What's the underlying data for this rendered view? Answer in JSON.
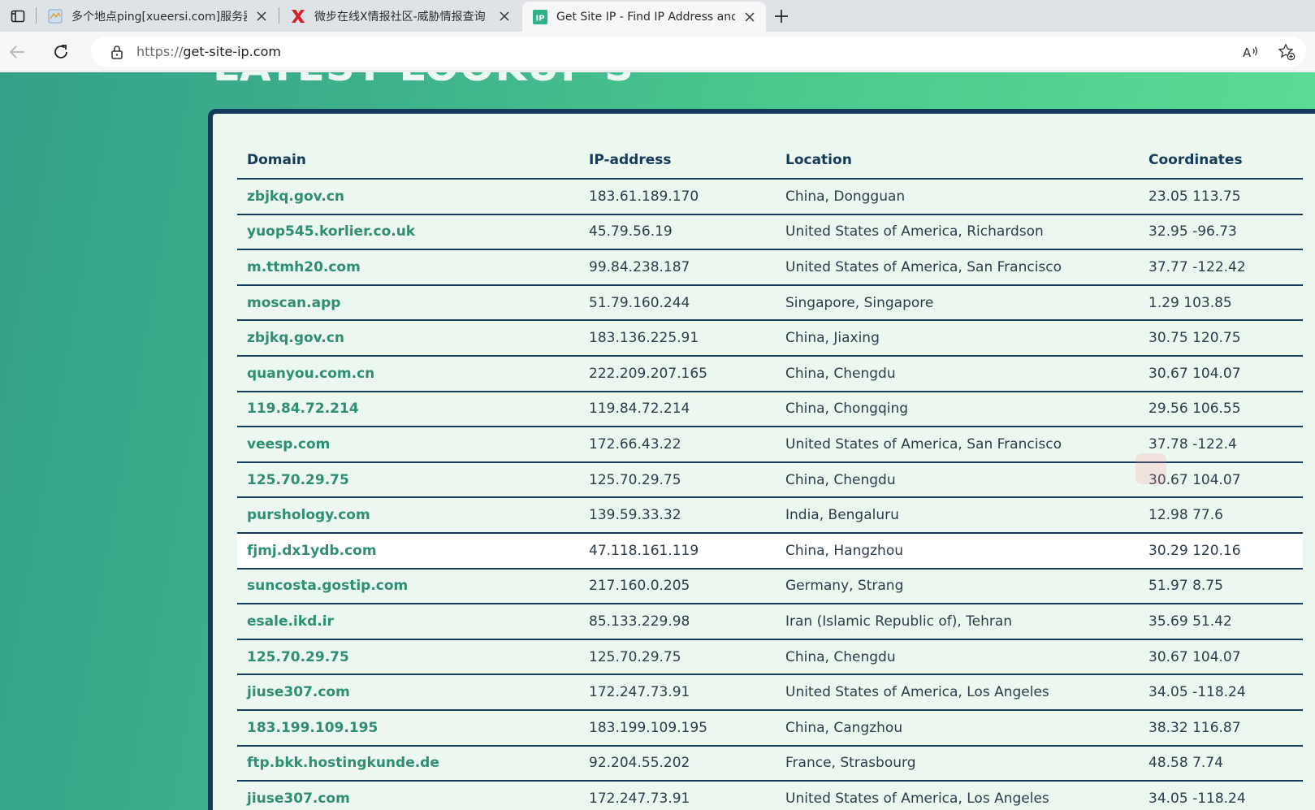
{
  "browser": {
    "tabs": [
      {
        "title": "多个地点ping[xueersi.com]服务器",
        "favicon": "globe-map-icon",
        "active": false
      },
      {
        "title": "微步在线X情报社区-威胁情报查询",
        "favicon": "x-logo-icon",
        "active": false
      },
      {
        "title": "Get Site IP - Find IP Address and",
        "favicon": "ip-logo-icon",
        "active": true
      }
    ],
    "address_bar": {
      "scheme": "https://",
      "host": "get-site-ip.com"
    },
    "colors": {
      "tab_strip": "#dfe3e8",
      "active_tab": "#f7f7f7",
      "x_logo": "#d6202a",
      "ip_logo": "#2bb38a"
    }
  },
  "page": {
    "heading": "LATEST LOOKUP'S",
    "table": {
      "headers": {
        "domain": "Domain",
        "ip": "IP-address",
        "location": "Location",
        "coordinates": "Coordinates"
      },
      "rows": [
        {
          "domain": "zbjkq.gov.cn",
          "ip": "183.61.189.170",
          "location": "China, Dongguan",
          "coordinates": "23.05 113.75"
        },
        {
          "domain": "yuop545.korlier.co.uk",
          "ip": "45.79.56.19",
          "location": "United States of America, Richardson",
          "coordinates": "32.95 -96.73"
        },
        {
          "domain": "m.ttmh20.com",
          "ip": "99.84.238.187",
          "location": "United States of America, San Francisco",
          "coordinates": "37.77 -122.42"
        },
        {
          "domain": "moscan.app",
          "ip": "51.79.160.244",
          "location": "Singapore, Singapore",
          "coordinates": "1.29 103.85"
        },
        {
          "domain": "zbjkq.gov.cn",
          "ip": "183.136.225.91",
          "location": "China, Jiaxing",
          "coordinates": "30.75 120.75"
        },
        {
          "domain": "quanyou.com.cn",
          "ip": "222.209.207.165",
          "location": "China, Chengdu",
          "coordinates": "30.67 104.07"
        },
        {
          "domain": "119.84.72.214",
          "ip": "119.84.72.214",
          "location": "China, Chongqing",
          "coordinates": "29.56 106.55"
        },
        {
          "domain": "veesp.com",
          "ip": "172.66.43.22",
          "location": "United States of America, San Francisco",
          "coordinates": "37.78 -122.4"
        },
        {
          "domain": "125.70.29.75",
          "ip": "125.70.29.75",
          "location": "China, Chengdu",
          "coordinates": "30.67 104.07"
        },
        {
          "domain": "purshology.com",
          "ip": "139.59.33.32",
          "location": "India, Bengaluru",
          "coordinates": "12.98 77.6"
        },
        {
          "domain": "fjmj.dx1ydb.com",
          "ip": "47.118.161.119",
          "location": "China, Hangzhou",
          "coordinates": "30.29 120.16",
          "highlighted": true
        },
        {
          "domain": "suncosta.gostip.com",
          "ip": "217.160.0.205",
          "location": "Germany, Strang",
          "coordinates": "51.97 8.75"
        },
        {
          "domain": "esale.ikd.ir",
          "ip": "85.133.229.98",
          "location": "Iran (Islamic Republic of), Tehran",
          "coordinates": "35.69 51.42"
        },
        {
          "domain": "125.70.29.75",
          "ip": "125.70.29.75",
          "location": "China, Chengdu",
          "coordinates": "30.67 104.07"
        },
        {
          "domain": "jiuse307.com",
          "ip": "172.247.73.91",
          "location": "United States of America, Los Angeles",
          "coordinates": "34.05 -118.24"
        },
        {
          "domain": "183.199.109.195",
          "ip": "183.199.109.195",
          "location": "China, Cangzhou",
          "coordinates": "38.32 116.87"
        },
        {
          "domain": "ftp.bkk.hostingkunde.de",
          "ip": "92.204.55.202",
          "location": "France, Strasbourg",
          "coordinates": "48.58 7.74"
        },
        {
          "domain": "jiuse307.com",
          "ip": "172.247.73.91",
          "location": "United States of America, Los Angeles",
          "coordinates": "34.05 -118.24"
        }
      ]
    },
    "colors": {
      "gradient_start": "#34a088",
      "gradient_end": "#5ee095",
      "card": "#ebf7ef",
      "border": "#153a5c",
      "domain_link": "#2e8f74",
      "text": "#2d3d4a"
    }
  }
}
